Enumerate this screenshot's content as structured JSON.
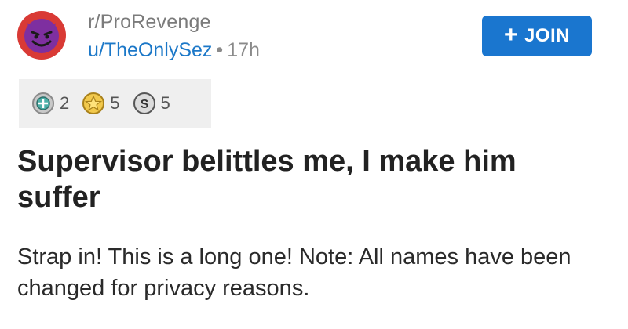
{
  "post": {
    "subreddit": "r/ProRevenge",
    "author": "u/TheOnlySez",
    "separator": "•",
    "age": "17h",
    "title": "Supervisor belittles me, I make him suffer",
    "body": "Strap in! This is a long one! Note: All names have been changed for privacy reasons."
  },
  "join_button": {
    "icon": "+",
    "label": "JOIN"
  },
  "awards": [
    {
      "icon": "platinum-award-icon",
      "count": "2"
    },
    {
      "icon": "gold-award-icon",
      "count": "5"
    },
    {
      "icon": "silver-award-icon",
      "count": "5"
    }
  ],
  "colors": {
    "accent": "#1a76cf",
    "username": "#1c78c8",
    "avatar_bg": "#d93a35",
    "avatar_face": "#7e2fa0"
  }
}
